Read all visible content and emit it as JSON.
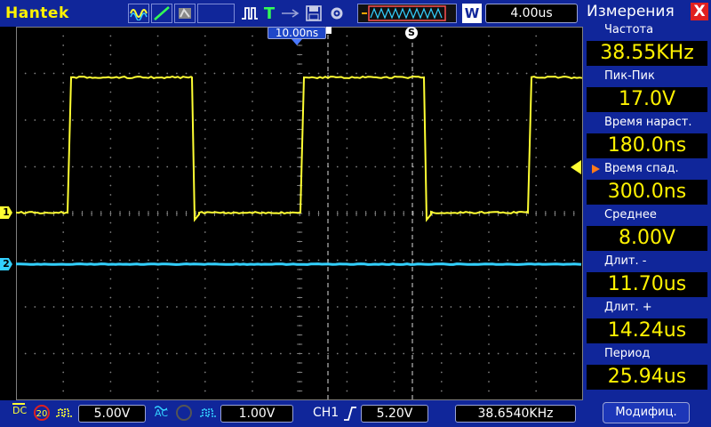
{
  "brand": "Hantek",
  "toolbar": {
    "trigger_mode_letter": "T",
    "waveform_letter": "W",
    "timebase": "4.00us"
  },
  "screen": {
    "delay_label": "10.00ns",
    "cursor_label": "S",
    "ch1_marker": "1",
    "ch2_marker": "2",
    "ch1_color": "#ffff33",
    "ch2_color": "#33d0ff",
    "grid_color": "#808080"
  },
  "bottom": {
    "ch1_coupling": "DC",
    "ch1_bandwidth": "20",
    "ch1_volts": "5.00V",
    "ch2_coupling": "AC",
    "ch2_volts": "1.00V",
    "trigger_source": "CH1",
    "trigger_level": "5.20V",
    "frequency": "38.6540KHz"
  },
  "panel": {
    "title": "Измерения",
    "close": "X",
    "measurements": [
      {
        "label": "Частота",
        "value": "38.55KHz",
        "selected": false
      },
      {
        "label": "Пик-Пик",
        "value": "17.0V",
        "selected": false
      },
      {
        "label": "Время нараст.",
        "value": "180.0ns",
        "selected": false
      },
      {
        "label": "Время спад.",
        "value": "300.0ns",
        "selected": true
      },
      {
        "label": "Среднее",
        "value": "8.00V",
        "selected": false
      },
      {
        "label": "Длит. -",
        "value": "11.70us",
        "selected": false
      },
      {
        "label": "Длит. +",
        "value": "14.24us",
        "selected": false
      },
      {
        "label": "Период",
        "value": "25.94us",
        "selected": false
      }
    ],
    "modify_label": "Модифиц."
  }
}
